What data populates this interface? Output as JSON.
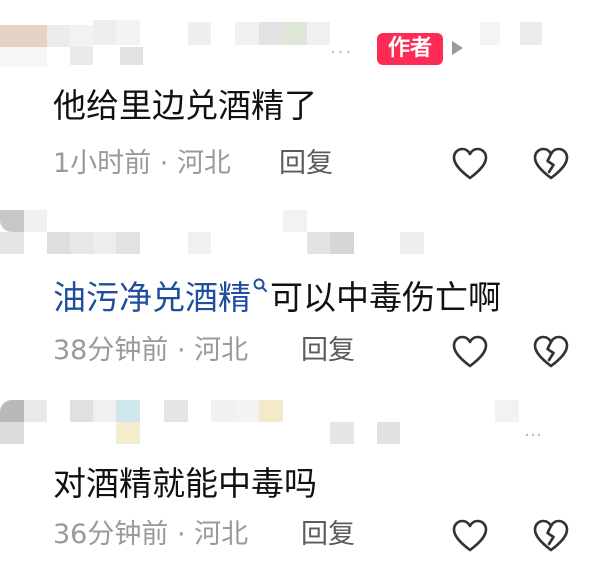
{
  "comments": [
    {
      "author_badge": "作者",
      "text": "他给里边兑酒精了",
      "time": "1小时前",
      "location": "河北",
      "reply_label": "回复"
    },
    {
      "link_text": "油污净兑酒精",
      "text": "可以中毒伤亡啊",
      "time": "38分钟前",
      "location": "河北",
      "reply_label": "回复"
    },
    {
      "text": "对酒精就能中毒吗",
      "time": "36分钟前",
      "location": "河北",
      "reply_label": "回复"
    }
  ],
  "separator": " · ",
  "ellipsis": "...",
  "ellipsis_alt": "…",
  "icons": {
    "like": "heart-outline-icon",
    "dislike": "broken-heart-outline-icon",
    "link": "search-icon",
    "play": "play-triangle-icon"
  },
  "colors": {
    "author_badge": "#fe2c55",
    "link_text": "#1f4e9c",
    "meta": "#9a9a9a",
    "reply": "#5b5b5b"
  }
}
